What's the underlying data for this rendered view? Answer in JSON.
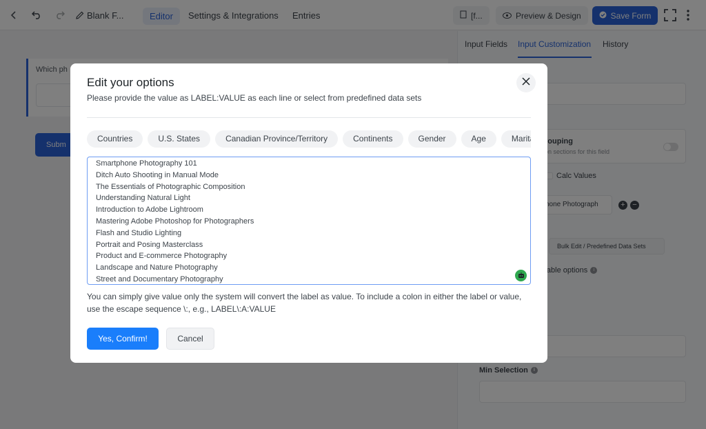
{
  "topbar": {
    "form_title": "Blank F...",
    "tabs": [
      "Editor",
      "Settings & Integrations",
      "Entries"
    ],
    "shortcode_label": "[f...",
    "preview_label": "Preview & Design",
    "save_label": "Save Form"
  },
  "canvas": {
    "question_label": "Which ph",
    "submit_label": "Subm"
  },
  "panel": {
    "tabs": [
      "Input Fields",
      "Input Customization",
      "History"
    ],
    "grouping_title": "rouping",
    "grouping_desc": "on sections for this field",
    "calc_values_label": "Calc Values",
    "option_value": "hone Photograph",
    "bulk_edit_label": "Bulk Edit / Predefined Data Sets",
    "available_options_label": "ilable options",
    "min_selection_label": "Min Selection"
  },
  "modal": {
    "title": "Edit your options",
    "subtitle": "Please provide the value as LABEL:VALUE as each line or select from predefined data sets",
    "chips": [
      "Countries",
      "U.S. States",
      "Canadian Province/Territory",
      "Continents",
      "Gender",
      "Age",
      "Marita"
    ],
    "options": [
      "Smartphone Photography 101",
      "Ditch Auto Shooting in Manual Mode",
      "The Essentials of Photographic Composition",
      "Understanding Natural Light",
      "Introduction to Adobe Lightroom",
      "Mastering Adobe Photoshop for Photographers",
      "Flash and Studio Lighting",
      "Portrait and Posing Masterclass",
      "Product and E-commerce Photography",
      "Landscape and Nature Photography",
      "Street and Documentary Photography"
    ],
    "help_text": "You can simply give value only the system will convert the label as value. To include a colon in either the label or value, use the escape sequence \\:, e.g., LABEL\\:A:VALUE",
    "confirm_label": "Yes, Confirm!",
    "cancel_label": "Cancel"
  },
  "colors": {
    "accent": "#2a62d8",
    "confirm": "#1a7efb",
    "ai_icon": "#2fa84f"
  },
  "icons": [
    "chevron-left-icon",
    "undo-icon",
    "redo-icon",
    "edit-icon",
    "file-icon",
    "eye-icon",
    "check-circle-icon",
    "fullscreen-icon",
    "more-vertical-icon",
    "close-icon",
    "plus-icon",
    "minus-icon",
    "info-icon",
    "robot-icon"
  ]
}
